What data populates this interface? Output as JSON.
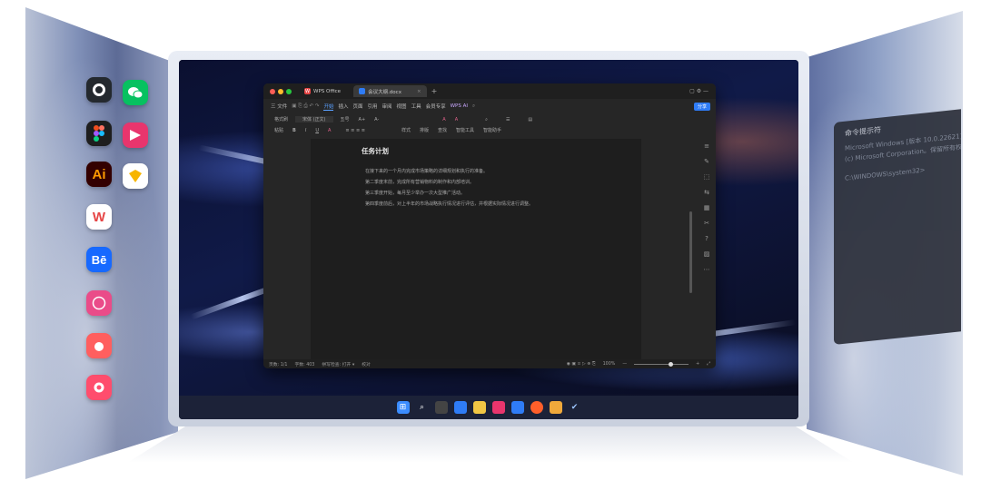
{
  "apps": [
    {
      "name": "github",
      "glyph": "",
      "bg": "#24292e"
    },
    {
      "name": "wechat",
      "glyph": "",
      "bg": "#07c160"
    },
    {
      "name": "figma",
      "glyph": "",
      "bg": "#f24e1e"
    },
    {
      "name": "app-pink",
      "glyph": "",
      "bg": "#e8356d"
    },
    {
      "name": "illustrator",
      "glyph": "Ai",
      "bg": "#330000"
    },
    {
      "name": "sketch",
      "glyph": "",
      "bg": "#f7b500"
    },
    {
      "name": "wps",
      "glyph": "W",
      "bg": "#ffffff"
    },
    {
      "name": "behance",
      "glyph": "Bē",
      "bg": "#1769ff"
    },
    {
      "name": "dribbble",
      "glyph": "",
      "bg": "#ea4c89"
    },
    {
      "name": "app-orange",
      "glyph": "",
      "bg": "#ff5f5f"
    },
    {
      "name": "app-red",
      "glyph": "",
      "bg": "#ff4d6d"
    }
  ],
  "cmd": {
    "title": "命令提示符",
    "lines": [
      "Microsoft Windows [版本 10.0.22621]",
      "(c) Microsoft Corporation。保留所有权利。",
      "",
      "C:\\WINDOWS\\system32>"
    ]
  },
  "wps": {
    "tabs": [
      {
        "label": "WPS Office"
      },
      {
        "label": "会议大纲.docx"
      }
    ],
    "menu": [
      "三 文件",
      "开始",
      "插入",
      "页面",
      "引用",
      "审阅",
      "视图",
      "工具",
      "会员专享",
      "WPS AI"
    ],
    "active_menu": "开始",
    "share": "分享",
    "ribbon_row1": [
      "格式刷",
      "宋体 (正文)",
      "五号",
      "A+",
      "A-",
      "样式",
      "查找",
      "文档助手"
    ],
    "ribbon_row2": [
      "粘贴",
      "B",
      "I",
      "U",
      "A",
      "样式",
      "排版",
      "查找",
      "智能工具",
      "智能助手"
    ],
    "doc_title": "任务计划",
    "paragraphs": [
      "在接下来的一个月内完成市场策略的详细规划和执行的准备。",
      "第二季度末前，完成所有营销物料的制作和内部培训。",
      "第三季度开始，每月至少举办一次大型推广活动。",
      "第四季度前后，对上半年的市场战略执行情况进行评估，并根据实际情况进行调整。"
    ],
    "status": {
      "page": "页数: 1/1",
      "words": "字数: 403",
      "spell": "拼写检查: 打开 ▾",
      "check": "校对",
      "zoom": "100%"
    }
  },
  "taskbar": [
    "start",
    "search",
    "taskview",
    "widgets",
    "explorer",
    "app1",
    "app2",
    "app3",
    "store",
    "check"
  ]
}
